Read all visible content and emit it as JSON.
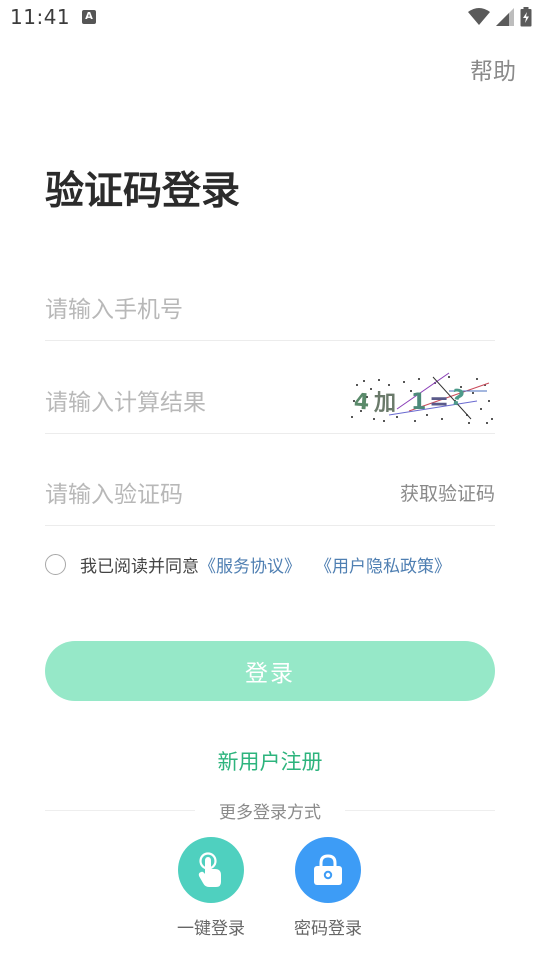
{
  "status_bar": {
    "time": "11:41",
    "notification_badge": "A"
  },
  "header": {
    "help_label": "帮助"
  },
  "page": {
    "title": "验证码登录"
  },
  "form": {
    "phone_placeholder": "请输入手机号",
    "calc_placeholder": "请输入计算结果",
    "captcha": {
      "num1": "4",
      "op": "加",
      "num2": "1",
      "eq": "=",
      "q": "?"
    },
    "code_placeholder": "请输入验证码",
    "get_code_label": "获取验证码"
  },
  "agreement": {
    "text": "我已阅读并同意",
    "service_link": "《服务协议》",
    "privacy_link": "《用户隐私政策》"
  },
  "login_button_label": "登录",
  "register_label": "新用户注册",
  "more_methods": {
    "title": "更多登录方式",
    "methods": [
      {
        "label": "一键登录",
        "icon": "tap-hand-icon",
        "color": "#4fd0bf"
      },
      {
        "label": "密码登录",
        "icon": "lock-icon",
        "color": "#3d9cf6"
      }
    ]
  },
  "colors": {
    "accent_green": "#2db47d",
    "button_disabled": "#96e8c8",
    "link_blue": "#4f7fb2"
  }
}
